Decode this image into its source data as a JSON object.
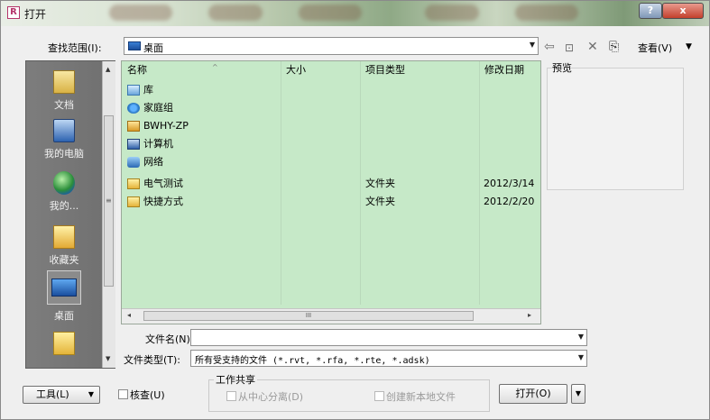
{
  "window": {
    "title": "打开",
    "app_icon": "R",
    "help_glyph": "?",
    "close_glyph": "x"
  },
  "lookin": {
    "label": "查找范围(I):",
    "value": "桌面"
  },
  "toolbar": {
    "back_glyph": "⇦",
    "up_glyph": "⊡",
    "delete_glyph": "✕",
    "newfolder_glyph": "⎘",
    "views_label": "查看(V)"
  },
  "places": [
    {
      "label": "文档",
      "icon": "documents-icon"
    },
    {
      "label": "我的电脑",
      "icon": "computer-icon"
    },
    {
      "label": "我的...",
      "icon": "network-globe-icon"
    },
    {
      "label": "收藏夹",
      "icon": "favorites-icon"
    },
    {
      "label": "桌面",
      "icon": "desktop-icon"
    },
    {
      "label": "",
      "icon": "folder-icon"
    }
  ],
  "columns": {
    "name": "名称",
    "size": "大小",
    "type": "项目类型",
    "modified": "修改日期"
  },
  "files": [
    {
      "name": "库",
      "size": "",
      "type": "",
      "modified": "",
      "icon": "library-icon"
    },
    {
      "name": "家庭组",
      "size": "",
      "type": "",
      "modified": "",
      "icon": "homegroup-icon"
    },
    {
      "name": "BWHY-ZP",
      "size": "",
      "type": "",
      "modified": "",
      "icon": "user-folder-icon"
    },
    {
      "name": "计算机",
      "size": "",
      "type": "",
      "modified": "",
      "icon": "computer-icon"
    },
    {
      "name": "网络",
      "size": "",
      "type": "",
      "modified": "",
      "icon": "network-icon"
    },
    {
      "name": "电气测试",
      "size": "",
      "type": "文件夹",
      "modified": "2012/3/14",
      "icon": "folder-icon"
    },
    {
      "name": "快捷方式",
      "size": "",
      "type": "文件夹",
      "modified": "2012/2/20",
      "icon": "folder-icon"
    }
  ],
  "hscroll": {
    "thumb_grip": "III"
  },
  "preview": {
    "label": "预览"
  },
  "filename": {
    "label": "文件名(N):",
    "value": ""
  },
  "filetype": {
    "label": "文件类型(T):",
    "value": "所有受支持的文件 (*.rvt, *.rfa, *.rte, *.adsk)"
  },
  "bottom": {
    "tools_label": "工具(L)",
    "audit_label": "核查(U)",
    "worksharing_title": "工作共享",
    "detach_label": "从中心分离(D)",
    "create_local_label": "创建新本地文件",
    "open_label": "打开(O)"
  },
  "colors": {
    "list_background": "#c6e9c8",
    "places_background": "#777777",
    "dialog_background": "#efefef"
  }
}
